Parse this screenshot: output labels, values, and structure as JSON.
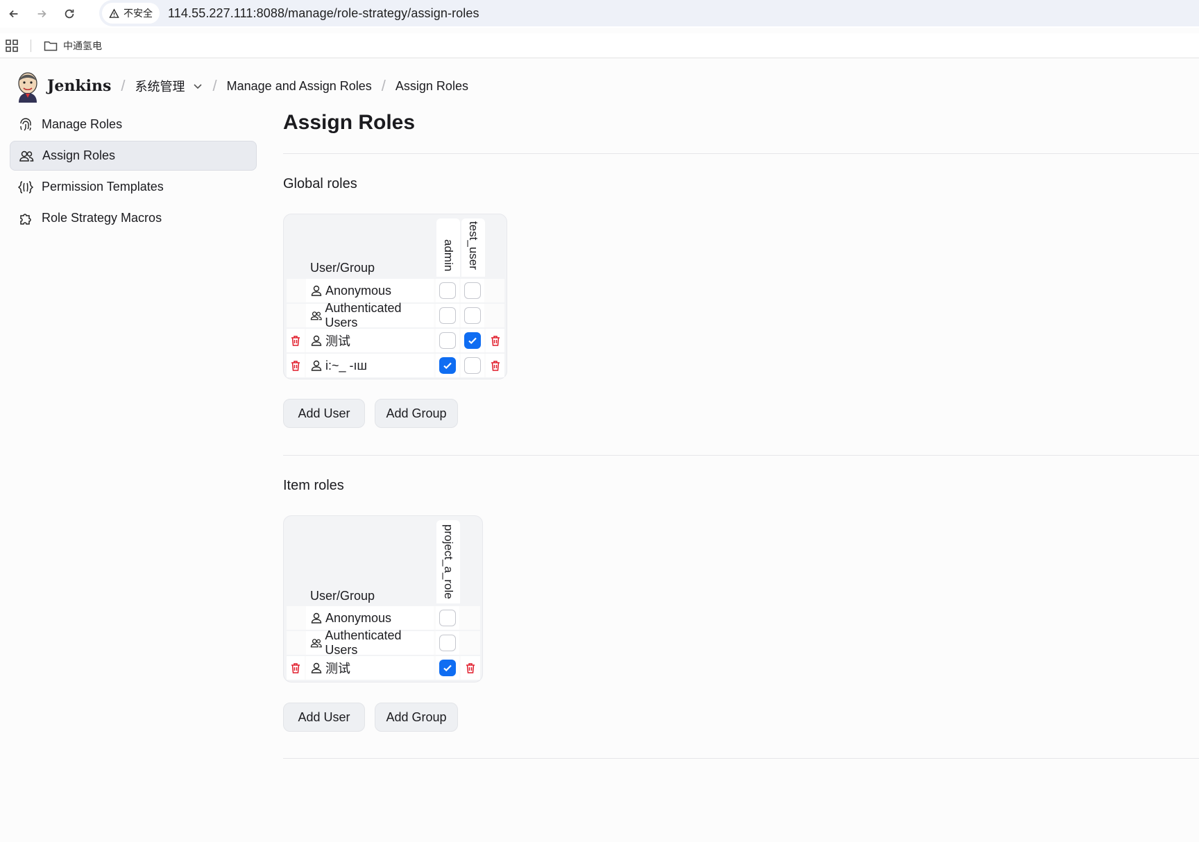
{
  "browser": {
    "security_label": "不安全",
    "url": "114.55.227.111:8088/manage/role-strategy/assign-roles",
    "bookmark": "中通氢电"
  },
  "header": {
    "app_name": "Jenkins",
    "breadcrumbs": [
      "系统管理",
      "Manage and Assign Roles",
      "Assign Roles"
    ]
  },
  "sidebar": {
    "items": [
      {
        "label": "Manage Roles",
        "icon": "fingerprint-icon"
      },
      {
        "label": "Assign Roles",
        "icon": "users-icon",
        "active": true
      },
      {
        "label": "Permission Templates",
        "icon": "braces-icon"
      },
      {
        "label": "Role Strategy Macros",
        "icon": "puzzle-icon"
      }
    ]
  },
  "main": {
    "title": "Assign Roles",
    "global": {
      "title": "Global roles",
      "header_label": "User/Group",
      "roles": [
        "admin",
        "test_user"
      ],
      "rows": [
        {
          "name": "Anonymous",
          "type": "user",
          "deletable": false,
          "checks": [
            false,
            false
          ]
        },
        {
          "name": "Authenticated Users",
          "type": "group",
          "deletable": false,
          "checks": [
            false,
            false
          ]
        },
        {
          "name": "测试",
          "type": "user",
          "deletable": true,
          "checks": [
            false,
            true
          ]
        },
        {
          "name": "i:~_ -ıш",
          "type": "user",
          "deletable": true,
          "checks": [
            true,
            false
          ]
        }
      ],
      "add_user": "Add User",
      "add_group": "Add Group"
    },
    "item": {
      "title": "Item roles",
      "header_label": "User/Group",
      "roles": [
        "project_a_role"
      ],
      "rows": [
        {
          "name": "Anonymous",
          "type": "user",
          "deletable": false,
          "checks": [
            false
          ]
        },
        {
          "name": "Authenticated Users",
          "type": "group",
          "deletable": false,
          "checks": [
            false
          ]
        },
        {
          "name": "测试",
          "type": "user",
          "deletable": true,
          "checks": [
            true
          ]
        }
      ],
      "add_user": "Add User",
      "add_group": "Add Group"
    }
  },
  "colors": {
    "accent": "#0f6df2",
    "danger": "#e11d2b"
  }
}
